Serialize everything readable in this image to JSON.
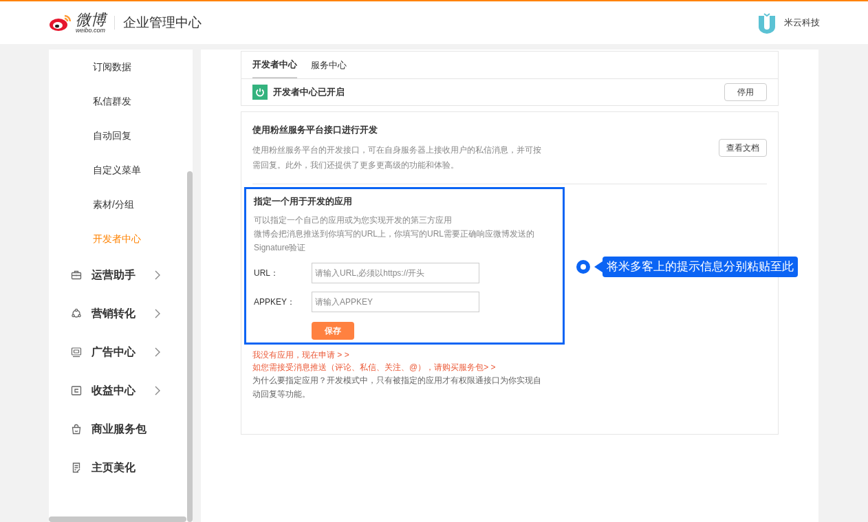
{
  "header": {
    "logo_text": "微博",
    "logo_subtext": "weibo.com",
    "title": "企业管理中心",
    "account": "米云科技"
  },
  "sidebar": {
    "sub_items": [
      {
        "label": "订阅数据",
        "selected": false
      },
      {
        "label": "私信群发",
        "selected": false
      },
      {
        "label": "自动回复",
        "selected": false
      },
      {
        "label": "自定义菜单",
        "selected": false
      },
      {
        "label": "素材/分组",
        "selected": false
      },
      {
        "label": "开发者中心",
        "selected": true
      }
    ],
    "items": [
      {
        "label": "运营助手",
        "expandable": true
      },
      {
        "label": "营销转化",
        "expandable": true
      },
      {
        "label": "广告中心",
        "expandable": true
      },
      {
        "label": "收益中心",
        "expandable": true
      },
      {
        "label": "商业服务包",
        "expandable": false
      },
      {
        "label": "主页美化",
        "expandable": false
      }
    ]
  },
  "tabs": [
    {
      "label": "开发者中心",
      "selected": true
    },
    {
      "label": "服务中心",
      "selected": false
    }
  ],
  "status": {
    "text": "开发者中心已开启",
    "on": true,
    "button": "停用"
  },
  "dev_card": {
    "title": "使用粉丝服务平台接口进行开发",
    "description": "使用粉丝服务平台的开发接口，可在自身服务器上接收用户的私信消息，并可按需回复。此外，我们还提供了更多更高级的功能和体验。",
    "button": "查看文档",
    "app_section": {
      "title": "指定一个用于开发的应用",
      "lines": [
        "可以指定一个自己的应用或为您实现开发的第三方应用",
        "微博会把消息推送到你填写的URL上，你填写的URL需要正确响应微博发送的Signature验证"
      ],
      "fields": [
        {
          "label": "URL：",
          "placeholder": "请输入URL,必须以https://开头"
        },
        {
          "label": "APPKEY：",
          "placeholder": "请输入APPKEY"
        }
      ],
      "save_button": "保存"
    },
    "links": [
      "我没有应用，现在申请 > >",
      "如您需接受消息推送（评论、私信、关注、@），请购买服务包> >"
    ],
    "note": "为什么要指定应用？开发模式中，只有被指定的应用才有权限通接口为你实现自动回复等功能。"
  },
  "annotation": {
    "text": "将米多客上的提示信息分别粘贴至此"
  }
}
